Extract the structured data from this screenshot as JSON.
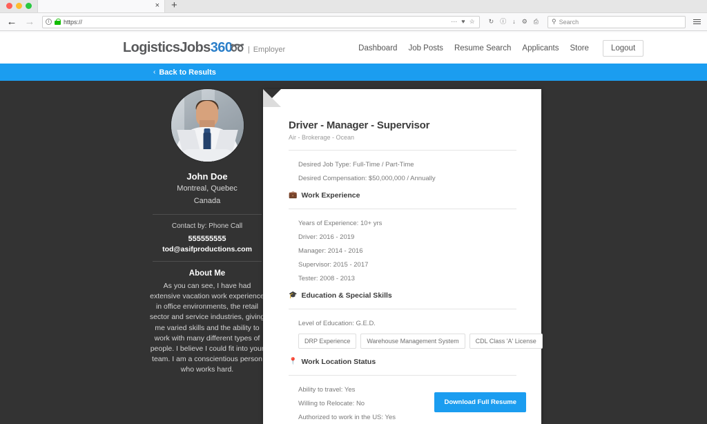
{
  "browser": {
    "tab_close_label": "×",
    "new_tab_label": "+",
    "back_label": "←",
    "forward_label": "→",
    "url_value": "https://",
    "reload_label": "↻",
    "search_placeholder": "Search",
    "icons": {
      "info": "i",
      "ellipsis": "···",
      "pocket": "♥",
      "bookmark_star": "☆",
      "reader": "ⓘ",
      "download": "↓",
      "gear": "⚙",
      "print": "⎙",
      "search": "⚲"
    }
  },
  "site": {
    "logo_main": "LogisticsJobs",
    "logo_accent": "360",
    "logo_swoosh": "➿",
    "logo_divider": "|",
    "logo_sub": "Employer",
    "nav": [
      {
        "label": "Dashboard"
      },
      {
        "label": "Job Posts"
      },
      {
        "label": "Resume Search"
      },
      {
        "label": "Applicants"
      },
      {
        "label": "Store"
      }
    ],
    "logout_label": "Logout",
    "subnav": {
      "chevron": "‹",
      "back_label": "Back to Results"
    }
  },
  "profile": {
    "avatar_name": "candidate-photo",
    "name": "John Doe",
    "location_line1": "Montreal, Quebec",
    "location_line2": "Canada",
    "contact_method": "Contact by: Phone Call",
    "phone": "555555555",
    "email": "tod@asifproductions.com",
    "about_title": "About Me",
    "about_text": "As you can see, I have had extensive vacation work experience in office environments, the retail sector and service industries, giving me varied skills and the ability to work with many different types of people. I believe I could fit into your team. I am a conscientious person who works hard."
  },
  "resume": {
    "title": "Driver - Manager - Supervisor",
    "subtitle": "Air - Brokerage - Ocean",
    "summary": [
      "Desired Job Type: Full-Time / Part-Time",
      "Desired Compensation: $50,000,000 / Annually"
    ],
    "work_experience": {
      "icon": "💼",
      "heading": "Work Experience",
      "items": [
        "Years of Experience: 10+ yrs",
        "Driver: 2016 - 2019",
        "Manager: 2014 - 2016",
        "Supervisor: 2015 - 2017",
        "Tester: 2008 - 2013"
      ]
    },
    "education": {
      "icon": "🎓",
      "heading": "Education & Special Skills",
      "level": "Level of Education: G.E.D.",
      "skills": [
        "DRP Experience",
        "Warehouse Management System",
        "CDL Class 'A' License"
      ]
    },
    "location_status": {
      "icon": "📍",
      "heading": "Work Location Status",
      "items": [
        "Ability to travel: Yes",
        "Willing to Relocate: No",
        "Authorized to work in the US: Yes"
      ]
    },
    "download_label": "Download Full Resume"
  },
  "colors": {
    "accent_blue": "#1b9df0",
    "logo_blue": "#2b7fc9",
    "page_bg": "#333333"
  }
}
